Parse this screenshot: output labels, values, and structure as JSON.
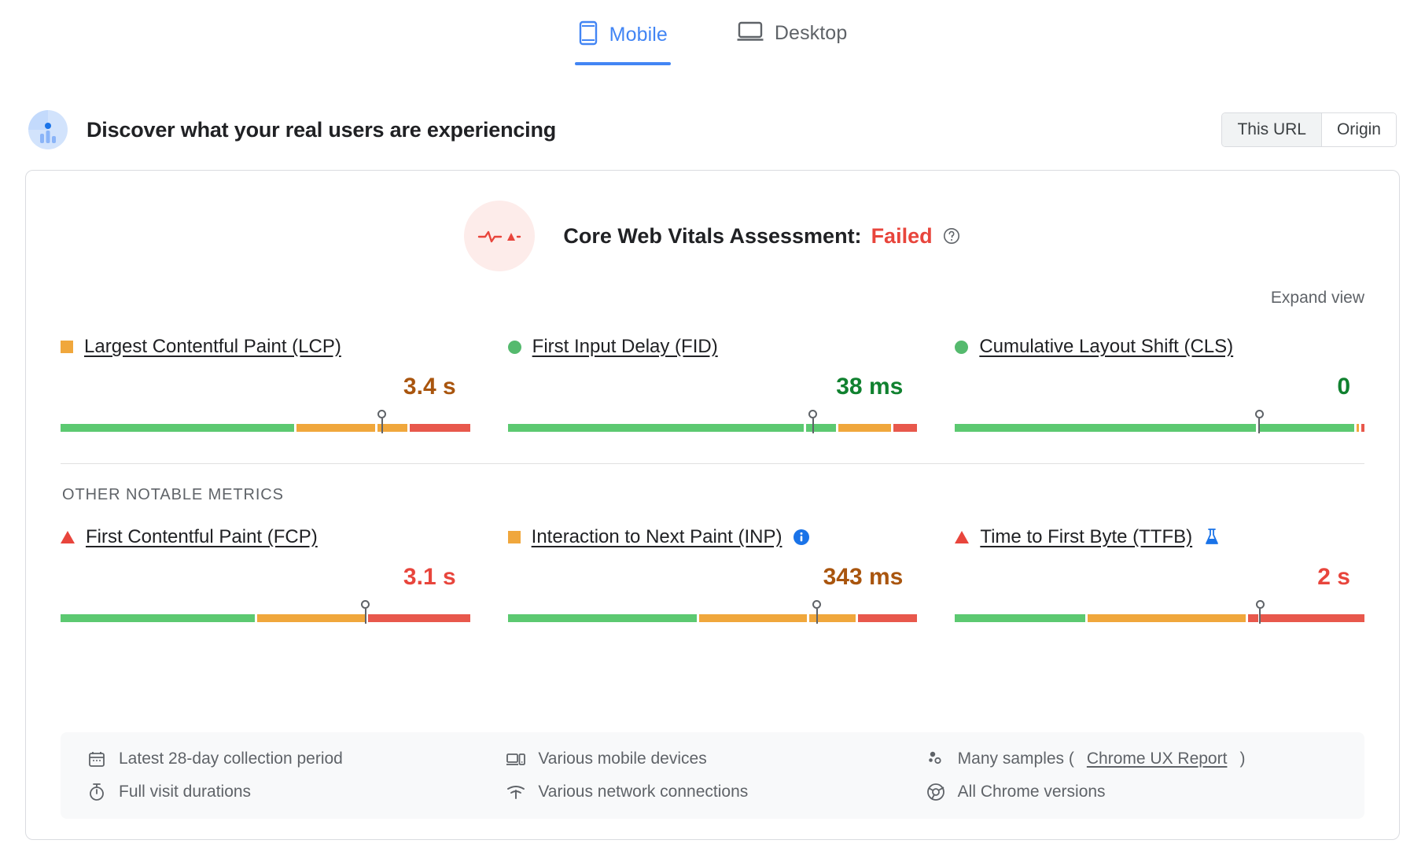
{
  "tabs": [
    {
      "label": "Mobile",
      "icon": "mobile-phone-icon",
      "active": true
    },
    {
      "label": "Desktop",
      "icon": "laptop-icon",
      "active": false
    }
  ],
  "discover": {
    "title": "Discover what your real users are experiencing",
    "avatar_icon": "real-user-data-icon",
    "scope_options": [
      {
        "label": "This URL",
        "selected": true
      },
      {
        "label": "Origin",
        "selected": false
      }
    ]
  },
  "assessment": {
    "badge_icon": "failing-pulse-icon",
    "title_prefix": "Core Web Vitals Assessment:",
    "status": "Failed",
    "status_color": "#e8453c",
    "help_icon": "help-circle-icon",
    "expand_label": "Expand view"
  },
  "sections": {
    "other_metrics_label": "OTHER NOTABLE METRICS"
  },
  "colors": {
    "good": "#5cc971",
    "needs_improvement": "#f0a73c",
    "poor": "#e8584c",
    "accent": "#4285f4",
    "fail_text": "#e8453c",
    "good_text": "#10812f",
    "ni_text": "#a9550e"
  },
  "core_web_vitals": [
    {
      "name": "Largest Contentful Paint (LCP)",
      "short": "LCP",
      "status_icon": "square",
      "status": "needs-improvement",
      "value": "3.4 s",
      "value_class": "v-orange",
      "marker_pct": 78.5,
      "distribution": [
        {
          "color": "good",
          "pct": 58
        },
        {
          "color": "needs-improvement",
          "pct": 19.5
        },
        {
          "color": "needs-improvement",
          "pct": 7.5
        },
        {
          "color": "poor",
          "pct": 15
        }
      ]
    },
    {
      "name": "First Input Delay (FID)",
      "short": "FID",
      "status_icon": "dot",
      "status": "good",
      "value": "38 ms",
      "value_class": "v-green",
      "marker_pct": 74.5,
      "distribution": [
        {
          "color": "good",
          "pct": 73.5
        },
        {
          "color": "good",
          "pct": 7.5
        },
        {
          "color": "needs-improvement",
          "pct": 13
        },
        {
          "color": "poor",
          "pct": 6
        }
      ]
    },
    {
      "name": "Cumulative Layout Shift (CLS)",
      "short": "CLS",
      "status_icon": "dot",
      "status": "good",
      "value": "0",
      "value_class": "v-green",
      "marker_pct": 74.3,
      "distribution": [
        {
          "color": "good",
          "pct": 73.5
        },
        {
          "color": "good",
          "pct": 23.5
        },
        {
          "color": "needs-improvement",
          "pct": 0.7
        },
        {
          "color": "poor",
          "pct": 0.7
        }
      ]
    }
  ],
  "other_metrics": [
    {
      "name": "First Contentful Paint (FCP)",
      "short": "FCP",
      "status_icon": "triangle",
      "status": "poor",
      "value": "3.1 s",
      "value_class": "v-red",
      "marker_pct": 74.5,
      "badge": null,
      "distribution": [
        {
          "color": "good",
          "pct": 47.5
        },
        {
          "color": "needs-improvement",
          "pct": 26.5
        },
        {
          "color": "poor",
          "pct": 25
        }
      ]
    },
    {
      "name": "Interaction to Next Paint (INP)",
      "short": "INP",
      "status_icon": "square",
      "status": "needs-improvement",
      "value": "343 ms",
      "value_class": "v-orange",
      "marker_pct": 75.5,
      "badge": "info-badge-icon",
      "distribution": [
        {
          "color": "good",
          "pct": 46.5
        },
        {
          "color": "needs-improvement",
          "pct": 26.5
        },
        {
          "color": "needs-improvement",
          "pct": 11.5
        },
        {
          "color": "poor",
          "pct": 14.5
        }
      ]
    },
    {
      "name": "Time to First Byte (TTFB)",
      "short": "TTFB",
      "status_icon": "triangle",
      "status": "poor",
      "value": "2 s",
      "value_class": "v-red",
      "marker_pct": 74.5,
      "badge": "experimental-flask-icon",
      "distribution": [
        {
          "color": "good",
          "pct": 32
        },
        {
          "color": "needs-improvement",
          "pct": 39
        },
        {
          "color": "poor",
          "pct": 2.5
        },
        {
          "color": "poor",
          "pct": 25.5
        }
      ]
    }
  ],
  "footer": [
    {
      "icon": "calendar-icon",
      "text": "Latest 28-day collection period",
      "link": null
    },
    {
      "icon": "mobile-devices-icon",
      "text": "Various mobile devices",
      "link": null
    },
    {
      "icon": "samples-icon",
      "text": "Many samples (",
      "link": "Chrome UX Report",
      "text_after": ")"
    },
    {
      "icon": "stopwatch-icon",
      "text": "Full visit durations",
      "link": null
    },
    {
      "icon": "network-icon",
      "text": "Various network connections",
      "link": null
    },
    {
      "icon": "chrome-icon",
      "text": "All Chrome versions",
      "link": null
    }
  ]
}
